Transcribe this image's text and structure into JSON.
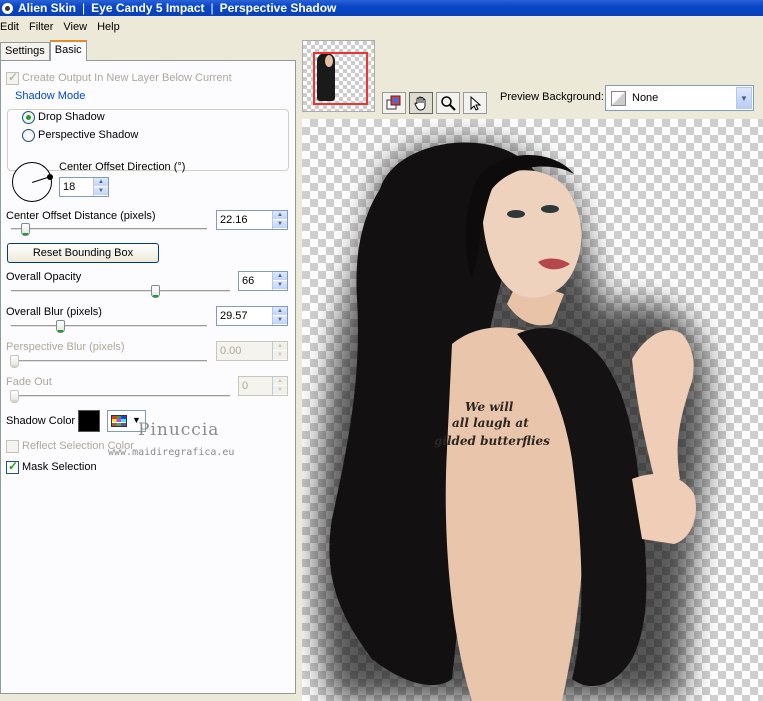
{
  "titlebar": {
    "parts": [
      "Alien Skin",
      "Eye Candy 5 Impact",
      "Perspective Shadow"
    ],
    "separator": "|"
  },
  "menu": [
    "Edit",
    "Filter",
    "View",
    "Help"
  ],
  "tabs": [
    "Settings",
    "Basic"
  ],
  "basic": {
    "create_output_label": "Create Output In New Layer Below Current",
    "shadow_mode_legend": "Shadow Mode",
    "drop_shadow_label": "Drop Shadow",
    "perspective_shadow_label": "Perspective Shadow",
    "center_offset_direction_label": "Center Offset Direction (°)",
    "center_offset_direction_value": "18",
    "center_offset_distance_label": "Center Offset Distance (pixels)",
    "center_offset_distance_value": "22.16",
    "reset_bounding_box_label": "Reset Bounding Box",
    "overall_opacity_label": "Overall Opacity",
    "overall_opacity_value": "66",
    "overall_blur_label": "Overall Blur (pixels)",
    "overall_blur_value": "29.57",
    "perspective_blur_label": "Perspective Blur (pixels)",
    "perspective_blur_value": "0.00",
    "fade_out_label": "Fade Out",
    "fade_out_value": "0",
    "shadow_color_label": "Shadow Color",
    "reflect_selection_label": "Reflect Selection Color",
    "mask_selection_label": "Mask Selection"
  },
  "watermark": {
    "name": "Pinuccia",
    "site": "www.maidiregrafica.eu"
  },
  "preview": {
    "background_label": "Preview Background:",
    "background_value": "None",
    "tattoo_lines": [
      "We will",
      "all laugh at",
      "gilded butterflies"
    ]
  },
  "colors": {
    "titlebar": "#0a46c9",
    "shadow_color": "#000000",
    "panel_bg": "#fcfcfe",
    "frame_bg": "#ece9d8"
  }
}
